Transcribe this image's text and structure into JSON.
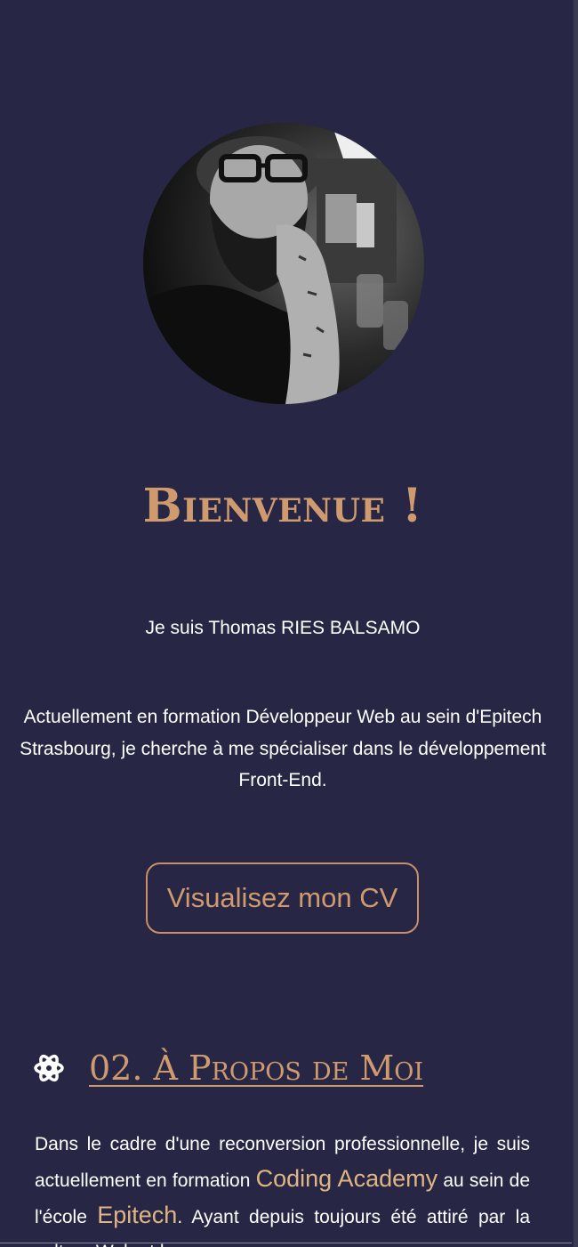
{
  "hero": {
    "avatar_alt": "Portrait de Thomas RIES BALSAMO",
    "welcome": "Bienvenue !",
    "name_line": "Je suis Thomas RIES BALSAMO",
    "intro": "Actuellement en formation Développeur Web au sein d'Epitech Strasbourg, je cherche à me spécialiser dans le développement Front-End.",
    "cv_button": "Visualisez mon CV"
  },
  "about": {
    "icon": "atom-gear-icon",
    "title": "02. À Propos de Moi",
    "text_1": "Dans le cadre d'une reconversion professionnelle, je suis actuellement en formation ",
    "highlight_1": "Coding Academy",
    "text_2": " au sein de l'école ",
    "highlight_2": "Epitech",
    "text_3": ". Ayant depuis toujours été attiré par la culture Web et le"
  },
  "colors": {
    "background": "#272745",
    "accent": "#d09a6f",
    "highlight": "#e0b584",
    "text": "#ffffff"
  }
}
